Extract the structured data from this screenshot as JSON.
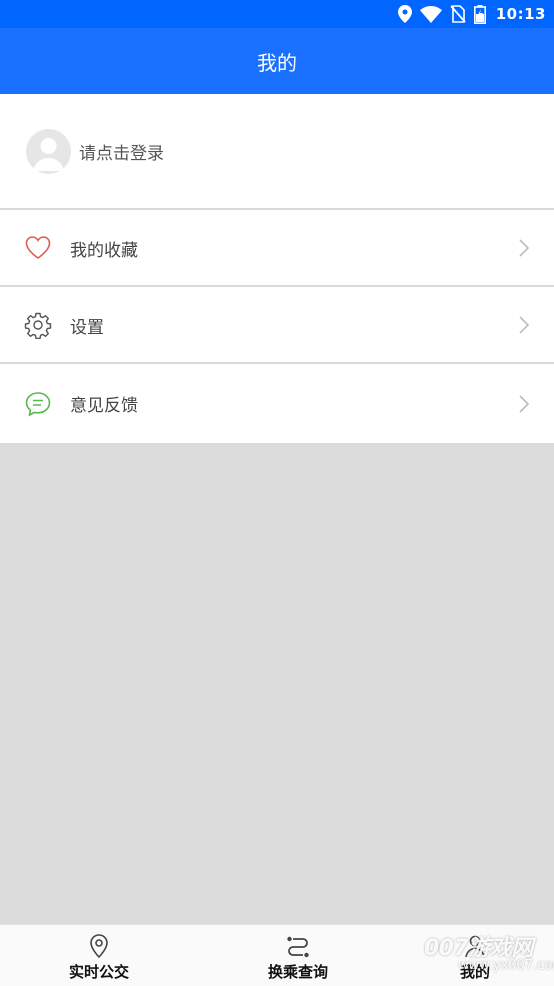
{
  "status_bar": {
    "time": "10:13",
    "icons": [
      "location-icon",
      "wifi-icon",
      "no-sim-icon",
      "battery-icon"
    ]
  },
  "app_bar": {
    "title": "我的"
  },
  "profile": {
    "login_prompt": "请点击登录"
  },
  "menu": {
    "items": [
      {
        "label": "我的收藏",
        "icon": "heart-icon"
      },
      {
        "label": "设置",
        "icon": "gear-icon"
      },
      {
        "label": "意见反馈",
        "icon": "chat-bubble-icon"
      }
    ]
  },
  "bottom_nav": {
    "items": [
      {
        "label": "实时公交",
        "icon": "location-pin-icon"
      },
      {
        "label": "换乘查询",
        "icon": "route-icon"
      },
      {
        "label": "我的",
        "icon": "person-icon"
      }
    ]
  },
  "colors": {
    "primary": "#1a70ff",
    "status_bar": "#0066ff",
    "heart": "#e25b4f",
    "feedback": "#56b84a",
    "background": "#dcdcdc"
  },
  "watermark": {
    "main": "007游戏网",
    "sub": "www.yx007.com"
  }
}
